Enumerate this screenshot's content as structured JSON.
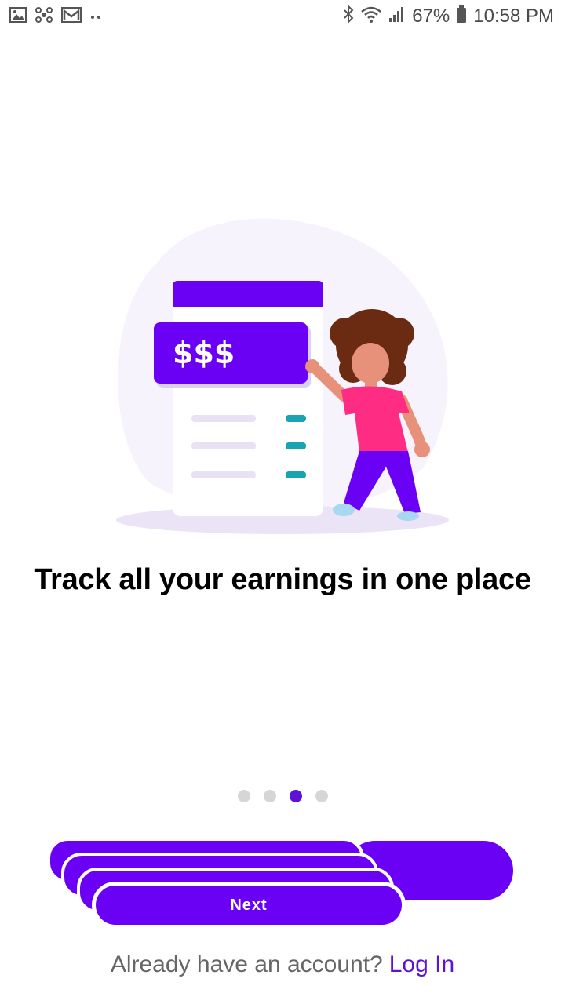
{
  "status_bar": {
    "battery": "67%",
    "time": "10:58 PM",
    "icons": [
      "gallery-icon",
      "network-icon",
      "gmail-icon",
      "more-dots-icon",
      "bluetooth-icon",
      "wifi-icon",
      "signal-icon",
      "battery-icon"
    ]
  },
  "illustration": {
    "card_text": "$$$"
  },
  "headline": "Track all your earnings in one place",
  "pager": {
    "count": 4,
    "active_index": 2
  },
  "primary_button": {
    "label": "Next"
  },
  "footer": {
    "prompt": "Already have an account?",
    "link": "Log In"
  },
  "colors": {
    "accent": "#6a00f4",
    "dot_active": "#5d12d6",
    "dot_inactive": "#d6d6d6"
  }
}
